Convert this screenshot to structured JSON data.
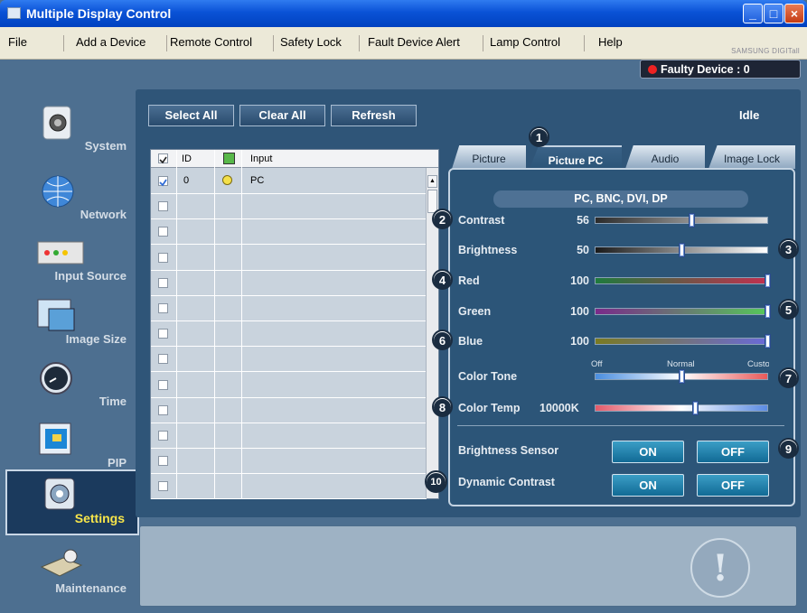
{
  "window": {
    "title": "Multiple Display Control",
    "minimize": "_",
    "maximize": "□",
    "close": "×"
  },
  "menu": [
    "File",
    "Add a Device",
    "Remote Control",
    "Safety Lock",
    "Fault Device Alert",
    "Lamp Control",
    "Help"
  ],
  "brand": "SAMSUNG DIGITall",
  "faulty": {
    "label": "Faulty Device : 0",
    "color": "#e22222"
  },
  "status": "Idle",
  "nav": [
    {
      "label": "System",
      "icon": "system-icon"
    },
    {
      "label": "Network",
      "icon": "network-icon"
    },
    {
      "label": "Input Source",
      "icon": "input-source-icon"
    },
    {
      "label": "Image Size",
      "icon": "image-size-icon"
    },
    {
      "label": "Time",
      "icon": "clock-icon"
    },
    {
      "label": "PIP",
      "icon": "pip-icon"
    },
    {
      "label": "Settings",
      "icon": "settings-icon",
      "selected": true
    },
    {
      "label": "Maintenance",
      "icon": "maintenance-icon"
    }
  ],
  "toolbar": {
    "select_all": "Select All",
    "clear_all": "Clear All",
    "refresh": "Refresh"
  },
  "table": {
    "headers": {
      "id": "ID",
      "input": "Input"
    },
    "rows": [
      {
        "checked": true,
        "id": "0",
        "power": "on",
        "input": "PC"
      },
      {
        "checked": false,
        "id": "",
        "power": "",
        "input": ""
      },
      {
        "checked": false,
        "id": "",
        "power": "",
        "input": ""
      },
      {
        "checked": false,
        "id": "",
        "power": "",
        "input": ""
      },
      {
        "checked": false,
        "id": "",
        "power": "",
        "input": ""
      },
      {
        "checked": false,
        "id": "",
        "power": "",
        "input": ""
      },
      {
        "checked": false,
        "id": "",
        "power": "",
        "input": ""
      },
      {
        "checked": false,
        "id": "",
        "power": "",
        "input": ""
      },
      {
        "checked": false,
        "id": "",
        "power": "",
        "input": ""
      },
      {
        "checked": false,
        "id": "",
        "power": "",
        "input": ""
      },
      {
        "checked": false,
        "id": "",
        "power": "",
        "input": ""
      },
      {
        "checked": false,
        "id": "",
        "power": "",
        "input": ""
      },
      {
        "checked": false,
        "id": "",
        "power": "",
        "input": ""
      }
    ]
  },
  "tabs": [
    "Picture",
    "Picture PC",
    "Audio",
    "Image Lock"
  ],
  "active_tab": "Picture PC",
  "source_header": "PC, BNC, DVI, DP",
  "controls": {
    "contrast": {
      "label": "Contrast",
      "value": "56",
      "level": 0.56
    },
    "brightness": {
      "label": "Brightness",
      "value": "50",
      "level": 0.5
    },
    "red": {
      "label": "Red",
      "value": "100",
      "level": 1.0
    },
    "green": {
      "label": "Green",
      "value": "100",
      "level": 1.0
    },
    "blue": {
      "label": "Blue",
      "value": "100",
      "level": 1.0
    },
    "color_tone": {
      "label": "Color Tone",
      "ticks": [
        "Off",
        "Normal",
        "Custom"
      ],
      "level": 0.5
    },
    "color_temp": {
      "label": "Color Temp",
      "value": "10000K",
      "level": 0.58
    },
    "brightness_sensor": {
      "label": "Brightness Sensor",
      "on": "ON",
      "off": "OFF"
    },
    "dynamic_contrast": {
      "label": "Dynamic Contrast",
      "on": "ON",
      "off": "OFF"
    }
  },
  "callouts": [
    "1",
    "2",
    "3",
    "4",
    "5",
    "6",
    "7",
    "8",
    "9",
    "10"
  ],
  "colors": {
    "title_bar": "#0a52d6",
    "panel": "#2f5578",
    "selected_label": "#f7e54a",
    "toggle": "#1a84b0"
  }
}
